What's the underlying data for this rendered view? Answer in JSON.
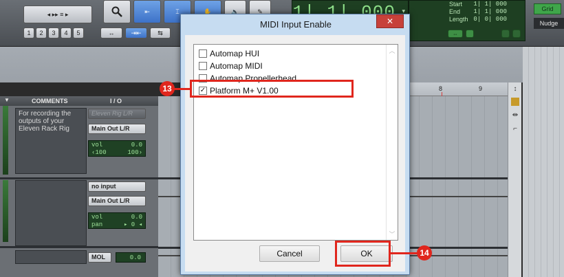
{
  "toolbar": {
    "edit_tools": [
      "1",
      "2",
      "3",
      "4",
      "5"
    ],
    "counter_main": "1| 1| 000",
    "selection": {
      "start_label": "Start",
      "start_value": "1| 1| 000",
      "end_label": "End",
      "end_value": "1| 1| 000",
      "length_label": "Length",
      "length_value": "0| 0| 000"
    },
    "grid_label": "Grid",
    "nudge_label": "Nudge"
  },
  "ruler": {
    "marks": [
      "8",
      "9"
    ]
  },
  "columns": {
    "comments": "COMMENTS",
    "io": "I / O"
  },
  "tracks": [
    {
      "comment": "For recording the outputs of your Eleven Rack Rig",
      "input": "Eleven Rig L/R",
      "output": "Main Out L/R",
      "vol_label": "vol",
      "vol_value": "0.0",
      "pan_left": "‹100",
      "pan_right": "100›"
    },
    {
      "comment": "",
      "input": "no input",
      "output": "Main Out L/R",
      "vol_label": "vol",
      "vol_value": "0.0",
      "pan_label": "pan",
      "pan_value": "▸ 0 ◂"
    }
  ],
  "master": {
    "label": "MOL",
    "value": "0.0"
  },
  "dialog": {
    "title": "MIDI Input Enable",
    "close": "✕",
    "items": [
      {
        "label": "Automap HUI",
        "checked": false
      },
      {
        "label": "Automap MIDI",
        "checked": false
      },
      {
        "label": "Automap Propellerhead",
        "checked": false
      },
      {
        "label": "Platform M+ V1.00",
        "checked": true
      }
    ],
    "check_glyph": "✓",
    "cancel": "Cancel",
    "ok": "OK"
  },
  "callouts": {
    "step_a": "13",
    "step_b": "14",
    "color": "#e0261d"
  }
}
